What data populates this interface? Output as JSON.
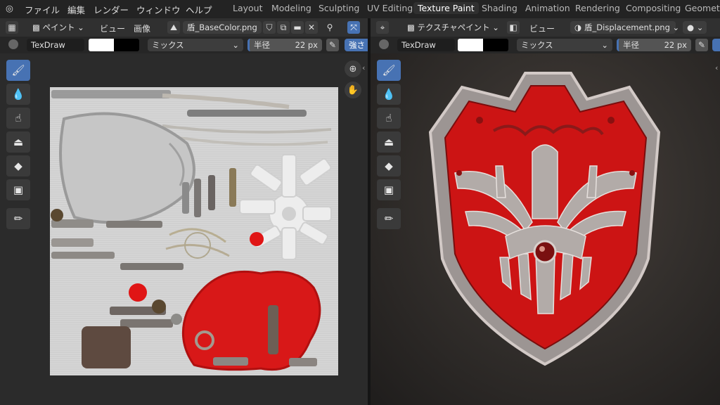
{
  "top_menu": {
    "items": [
      "ファイル",
      "編集",
      "レンダー",
      "ウィンドウ",
      "ヘルプ"
    ],
    "workspaces": [
      "Layout",
      "Modeling",
      "Sculpting",
      "UV Editing",
      "Texture Paint",
      "Shading",
      "Animation",
      "Rendering",
      "Compositing",
      "Geometry"
    ],
    "active_workspace": "Texture Paint"
  },
  "left_editor": {
    "mode": "ペイント",
    "view_menu": "ビュー",
    "image_menu": "画像",
    "image_name": "盾_BaseColor.png",
    "brush_name": "TexDraw",
    "blend_mode": "ミックス",
    "radius_label": "半径",
    "radius_value": "22 px",
    "strength_label": "強さ"
  },
  "right_editor": {
    "mode": "テクスチャペイント",
    "view_menu": "ビュー",
    "image_name": "盾_Displacement.png",
    "brush_name": "TexDraw",
    "blend_mode": "ミックス",
    "radius_label": "半径",
    "radius_value": "22 px"
  },
  "tools": [
    "draw-icon",
    "soften-icon",
    "smear-icon",
    "clone-icon",
    "fill-icon",
    "mask-icon",
    "annotate-icon"
  ],
  "colors": {
    "accent": "#4772b3",
    "shield_red": "#d01818",
    "shield_metal": "#a9a4a2"
  }
}
